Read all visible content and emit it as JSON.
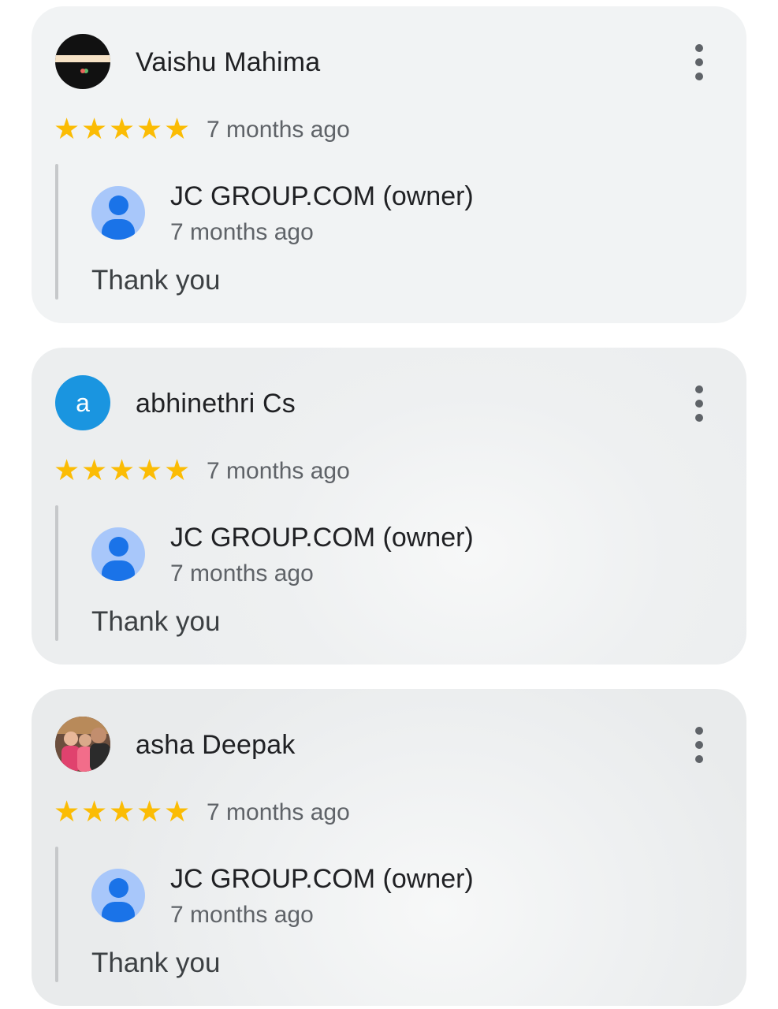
{
  "reviews": [
    {
      "reviewer_name": "Vaishu Mahima",
      "avatar_type": "image",
      "rating": 5,
      "time": "7 months ago",
      "reply": {
        "owner_name": "JC GROUP.COM (owner)",
        "time": "7 months ago",
        "text": "Thank you"
      }
    },
    {
      "reviewer_name": "abhinethri Cs",
      "avatar_type": "letter",
      "avatar_letter": "a",
      "rating": 5,
      "time": "7 months ago",
      "reply": {
        "owner_name": "JC GROUP.COM (owner)",
        "time": "7 months ago",
        "text": "Thank you"
      }
    },
    {
      "reviewer_name": "asha Deepak",
      "avatar_type": "photo",
      "rating": 5,
      "time": "7 months ago",
      "reply": {
        "owner_name": "JC GROUP.COM (owner)",
        "time": "7 months ago",
        "text": "Thank you"
      }
    }
  ],
  "icons": {
    "menu": "more-vert-icon",
    "star": "star-icon",
    "owner_avatar": "default-account-icon"
  },
  "colors": {
    "star": "#fbbc04",
    "letter_avatar": "#1a95e0",
    "card": "#f1f3f4",
    "owner_avatar_bg": "#a8c7fa",
    "owner_avatar_fg": "#1a73e8"
  }
}
